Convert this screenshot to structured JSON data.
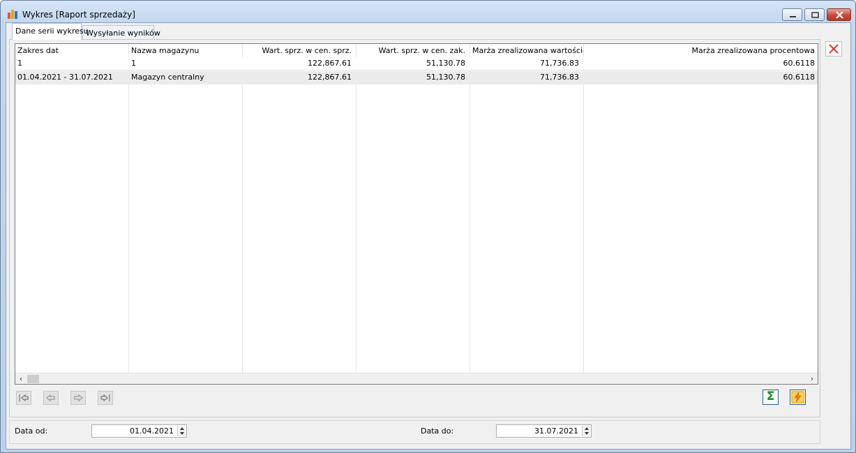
{
  "window": {
    "title": "Wykres [Raport sprzedaży]"
  },
  "tabs": [
    {
      "label": "Dane serii wykresu",
      "active": true
    },
    {
      "label": "Wysyłanie wyników",
      "active": false
    }
  ],
  "table": {
    "columns": [
      "Zakres dat",
      "Nazwa magazynu",
      "Wart. sprz. w cen. sprz.",
      "Wart. sprz. w cen. zak.",
      "Marża zrealizowana wartościowa",
      "Marża zrealizowana procentowa"
    ],
    "rows": [
      [
        "1",
        "1",
        "122,867.61",
        "51,130.78",
        "71,736.83",
        "60.6118"
      ],
      [
        "01.04.2021 - 31.07.2021",
        "Magazyn centralny",
        "122,867.61",
        "51,130.78",
        "71,736.83",
        "60.6118"
      ]
    ]
  },
  "filters": {
    "date_from_label": "Data od:",
    "date_from_value": "01.04.2021",
    "date_to_label": "Data do:",
    "date_to_value": "31.07.2021"
  },
  "colors": {
    "close_accent": "#d93a3a",
    "sum_icon": "#1f8a2e",
    "selected_row": "#ebebeb"
  }
}
